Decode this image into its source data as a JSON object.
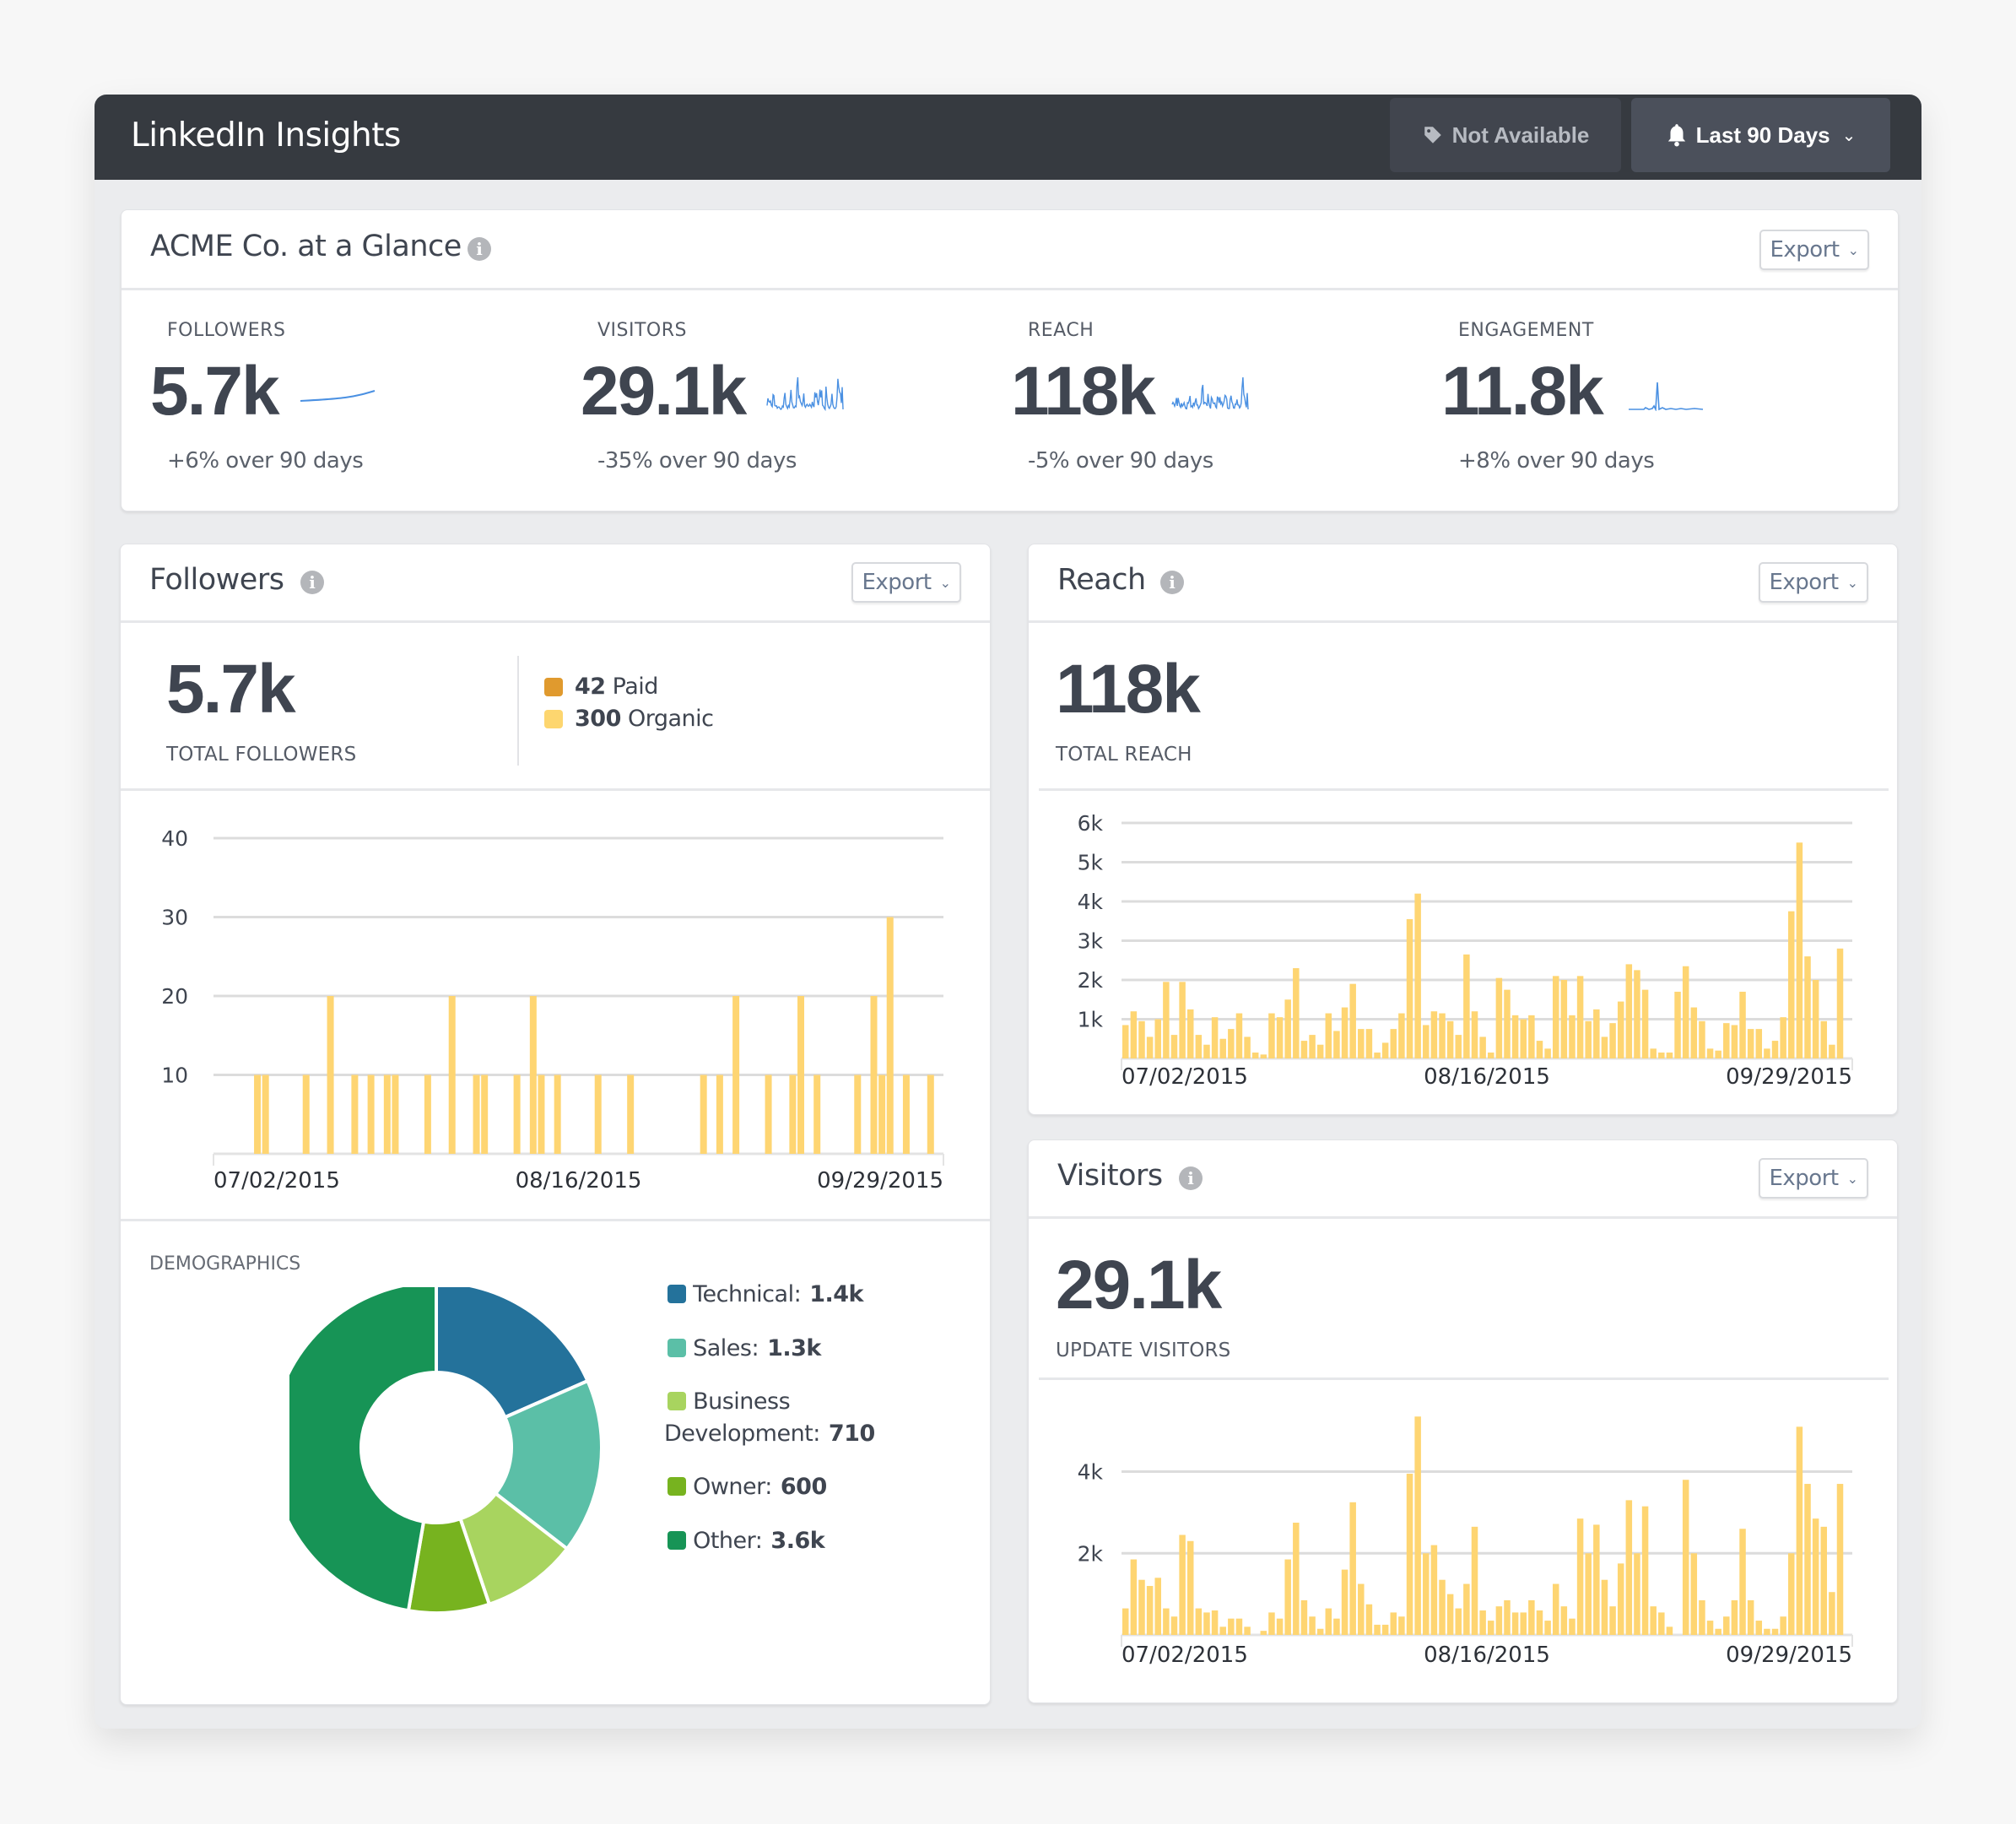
{
  "app": {
    "title": "LinkedIn Insights",
    "buttons": {
      "not_available": "Not Available",
      "date_range": "Last 90 Days"
    }
  },
  "glance": {
    "title": "ACME Co. at a Glance",
    "export_label": "Export",
    "kpis": [
      {
        "label": "FOLLOWERS",
        "value": "5.7k",
        "change": "+6% over 90 days",
        "spark": "trend"
      },
      {
        "label": "VISITORS",
        "value": "29.1k",
        "change": "-35% over 90 days",
        "spark": "bars"
      },
      {
        "label": "REACH",
        "value": "118k",
        "change": "-5% over 90 days",
        "spark": "bars"
      },
      {
        "label": "ENGAGEMENT",
        "value": "11.8k",
        "change": "+8% over 90 days",
        "spark": "spike"
      }
    ]
  },
  "followers": {
    "title": "Followers",
    "export_label": "Export",
    "total": "5.7k",
    "total_label": "TOTAL FOLLOWERS",
    "legend": [
      {
        "count": "42",
        "label": "Paid",
        "color": "#e09a2e"
      },
      {
        "count": "300",
        "label": "Organic",
        "color": "#fdd66f"
      }
    ],
    "demographics_title": "DEMOGRAPHICS"
  },
  "reach": {
    "title": "Reach",
    "export_label": "Export",
    "total": "118k",
    "total_label": "TOTAL REACH"
  },
  "visitors": {
    "title": "Visitors",
    "export_label": "Export",
    "total": "29.1k",
    "total_label": "UPDATE VISITORS"
  },
  "colors": {
    "bar": "#fed572",
    "sparkline": "#4a90e2",
    "grid": "#dcdcdc"
  },
  "chart_data": [
    {
      "id": "followers",
      "type": "bar",
      "title": "Followers",
      "xlabel": "",
      "ylabel": "",
      "x_tick_labels": [
        "07/02/2015",
        "08/16/2015",
        "09/29/2015"
      ],
      "y_ticks": [
        10,
        20,
        30,
        40
      ],
      "y_tick_labels": [
        "10",
        "20",
        "30",
        "40"
      ],
      "ylim": [
        0,
        40
      ],
      "days": 90,
      "grid": true,
      "points": [
        {
          "day": 5,
          "value": 10
        },
        {
          "day": 6,
          "value": 10
        },
        {
          "day": 11,
          "value": 10
        },
        {
          "day": 14,
          "value": 20
        },
        {
          "day": 17,
          "value": 10
        },
        {
          "day": 19,
          "value": 10
        },
        {
          "day": 21,
          "value": 10
        },
        {
          "day": 22,
          "value": 10
        },
        {
          "day": 26,
          "value": 10
        },
        {
          "day": 29,
          "value": 20
        },
        {
          "day": 32,
          "value": 10
        },
        {
          "day": 33,
          "value": 10
        },
        {
          "day": 37,
          "value": 10
        },
        {
          "day": 39,
          "value": 20
        },
        {
          "day": 40,
          "value": 10
        },
        {
          "day": 42,
          "value": 10
        },
        {
          "day": 47,
          "value": 10
        },
        {
          "day": 51,
          "value": 10
        },
        {
          "day": 60,
          "value": 10
        },
        {
          "day": 62,
          "value": 10
        },
        {
          "day": 64,
          "value": 20
        },
        {
          "day": 68,
          "value": 10
        },
        {
          "day": 71,
          "value": 10
        },
        {
          "day": 72,
          "value": 20
        },
        {
          "day": 74,
          "value": 10
        },
        {
          "day": 79,
          "value": 10
        },
        {
          "day": 81,
          "value": 20
        },
        {
          "day": 82,
          "value": 10
        },
        {
          "day": 83,
          "value": 30
        },
        {
          "day": 85,
          "value": 10
        },
        {
          "day": 88,
          "value": 10
        }
      ]
    },
    {
      "id": "reach",
      "type": "bar",
      "title": "Reach",
      "xlabel": "",
      "ylabel": "",
      "x_tick_labels": [
        "07/02/2015",
        "08/16/2015",
        "09/29/2015"
      ],
      "y_ticks": [
        1000,
        2000,
        3000,
        4000,
        5000,
        6000
      ],
      "y_tick_labels": [
        "1k",
        "2k",
        "3k",
        "4k",
        "5k",
        "6k"
      ],
      "ylim": [
        0,
        6000
      ],
      "grid": true,
      "values": [
        850,
        1200,
        950,
        550,
        1000,
        1950,
        600,
        1950,
        1250,
        600,
        350,
        1050,
        500,
        750,
        1150,
        550,
        150,
        100,
        1150,
        1050,
        1500,
        2300,
        450,
        600,
        350,
        1150,
        700,
        1300,
        1900,
        750,
        750,
        150,
        400,
        750,
        1150,
        3550,
        4200,
        850,
        1200,
        1150,
        950,
        600,
        2650,
        1200,
        550,
        150,
        2050,
        1750,
        1100,
        1000,
        1100,
        450,
        250,
        2100,
        2000,
        1100,
        2100,
        950,
        1250,
        550,
        900,
        1450,
        2400,
        2250,
        1750,
        250,
        150,
        150,
        1700,
        2350,
        1300,
        950,
        250,
        200,
        900,
        850,
        1700,
        750,
        750,
        250,
        450,
        1050,
        3750,
        5500,
        2600,
        2000,
        950,
        350,
        2800,
        0
      ]
    },
    {
      "id": "visitors",
      "type": "bar",
      "title": "Visitors",
      "xlabel": "",
      "ylabel": "",
      "x_tick_labels": [
        "07/02/2015",
        "08/16/2015",
        "09/29/2015"
      ],
      "y_ticks": [
        2000,
        4000
      ],
      "y_tick_labels": [
        "2k",
        "4k"
      ],
      "ylim": [
        0,
        5500
      ],
      "grid": true,
      "values": [
        650,
        1850,
        1350,
        1200,
        1400,
        650,
        450,
        2450,
        2300,
        650,
        550,
        600,
        200,
        400,
        400,
        200,
        0,
        100,
        550,
        400,
        1850,
        2750,
        850,
        450,
        150,
        650,
        400,
        1600,
        3250,
        1250,
        750,
        250,
        250,
        550,
        450,
        3950,
        5350,
        2000,
        2200,
        1350,
        1000,
        650,
        1250,
        2650,
        600,
        350,
        700,
        850,
        550,
        550,
        850,
        600,
        350,
        1250,
        700,
        400,
        2850,
        2000,
        2700,
        1350,
        700,
        1750,
        3300,
        2000,
        3150,
        700,
        550,
        200,
        0,
        3800,
        2000,
        850,
        350,
        150,
        450,
        850,
        2600,
        850,
        350,
        150,
        150,
        450,
        2000,
        5100,
        3700,
        2850,
        2650,
        1050,
        3700,
        0
      ]
    },
    {
      "id": "demographics",
      "type": "pie",
      "title": "DEMOGRAPHICS",
      "donut": true,
      "slices": [
        {
          "label": "Technical",
          "display": "1.4k",
          "value": 1400,
          "color": "#24729b"
        },
        {
          "label": "Sales",
          "display": "1.3k",
          "value": 1300,
          "color": "#5bbfa7"
        },
        {
          "label": "Business Development",
          "display": "710",
          "value": 710,
          "color": "#a8d45f"
        },
        {
          "label": "Owner",
          "display": "600",
          "value": 600,
          "color": "#77b31f"
        },
        {
          "label": "Other",
          "display": "3.6k",
          "value": 3600,
          "color": "#179456"
        }
      ]
    }
  ]
}
